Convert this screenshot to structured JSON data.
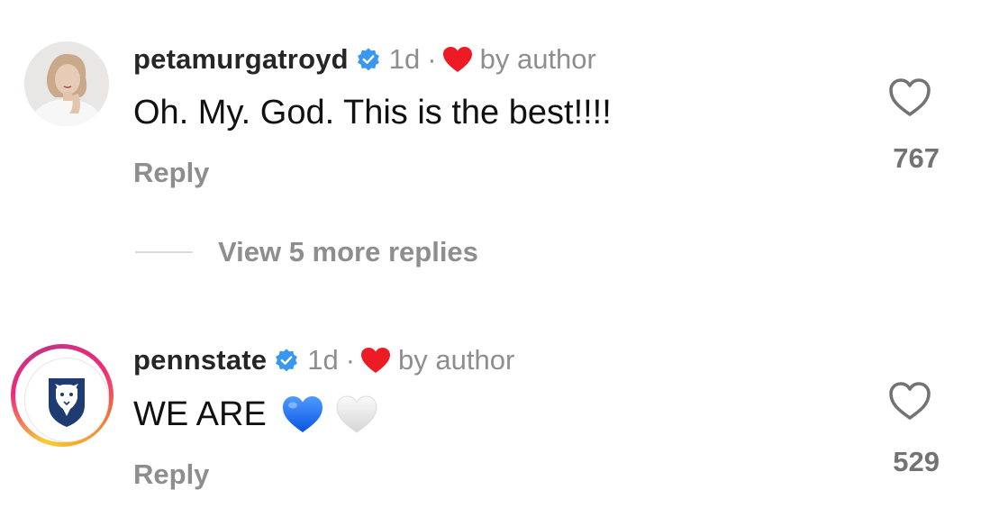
{
  "comments": [
    {
      "username": "petamurgatroyd",
      "verified": true,
      "time": "1d",
      "separator": "·",
      "liked_by_author": "by author",
      "text": "Oh. My. God. This is the best!!!!",
      "reply_label": "Reply",
      "like_count": "767",
      "avatar_icon": "profile-photo"
    },
    {
      "username": "pennstate",
      "verified": true,
      "time": "1d",
      "separator": "·",
      "liked_by_author": "by author",
      "text": "WE ARE",
      "emojis": [
        "blue-heart",
        "white-heart"
      ],
      "reply_label": "Reply",
      "like_count": "529",
      "avatar_icon": "penn-state-nittany-lion-logo"
    }
  ],
  "view_more_replies": "View 5 more replies",
  "colors": {
    "verified": "#3897f0",
    "author_heart": "#ed1c24",
    "muted": "#8e8e8e",
    "blue_heart": "#1a6cff"
  }
}
